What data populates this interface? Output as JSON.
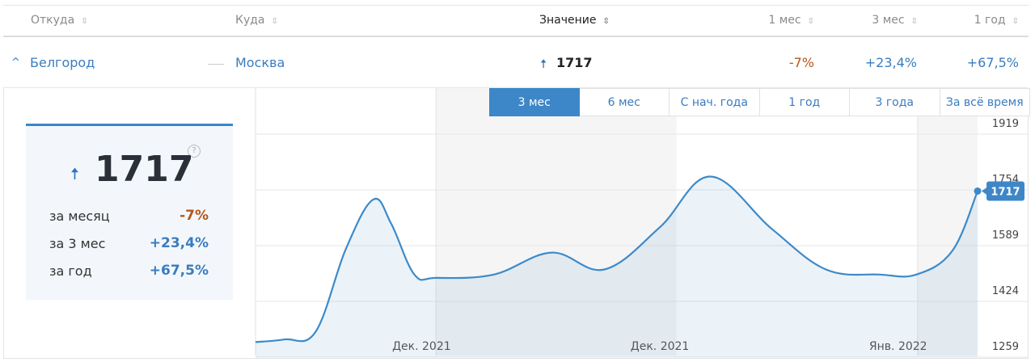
{
  "table": {
    "headers": [
      {
        "label": "Откуда"
      },
      {
        "label": "Куда"
      },
      {
        "label": "Значение"
      },
      {
        "label": "1 мес"
      },
      {
        "label": "3 мес"
      },
      {
        "label": "1 год"
      }
    ],
    "row": {
      "from": "Белгород",
      "to": "Москва",
      "value": "1717",
      "m1": "-7%",
      "m3": "+23,4%",
      "y1": "+67,5%"
    }
  },
  "summary": {
    "value": "1717",
    "help": "?",
    "rows": [
      {
        "label": "за месяц",
        "value": "-7%"
      },
      {
        "label": "за 3 мес",
        "value": "+23,4%"
      },
      {
        "label": "за год",
        "value": "+67,5%"
      }
    ]
  },
  "tabs": [
    "3 мес",
    "6 мес",
    "С нач. года",
    "1 год",
    "3 года",
    "За всё время"
  ],
  "active_tab": 0,
  "colors": {
    "accent": "#3d87c8",
    "line": "#3d8ac9",
    "negative": "#b5561b",
    "positive": "#3a7cbf"
  },
  "icons": {
    "sort": "sort-arrows-icon",
    "trend": "arrow-up-icon",
    "collapse": "chevron-up-icon",
    "help": "question-circle-icon"
  },
  "chart_data": {
    "type": "area",
    "y_ticks": [
      1259,
      1424,
      1589,
      1754,
      1919
    ],
    "ylim": [
      1259,
      1919
    ],
    "x_labels": [
      {
        "label": "Дек. 2021",
        "x": 0.23
      },
      {
        "label": "Дек. 2021",
        "x": 0.56
      },
      {
        "label": "Янв. 2022",
        "x": 0.89
      }
    ],
    "bands": [
      [
        0.25,
        0.583
      ],
      [
        0.917,
        1.0
      ]
    ],
    "x": [
      0,
      0.04,
      0.083,
      0.125,
      0.163,
      0.188,
      0.22,
      0.25,
      0.33,
      0.41,
      0.483,
      0.56,
      0.63,
      0.715,
      0.79,
      0.865,
      0.915,
      0.965,
      1.0
    ],
    "values": [
      1270,
      1278,
      1300,
      1545,
      1692,
      1620,
      1470,
      1460,
      1470,
      1535,
      1485,
      1610,
      1760,
      1605,
      1485,
      1470,
      1470,
      1540,
      1717
    ],
    "last_value": "1717"
  }
}
